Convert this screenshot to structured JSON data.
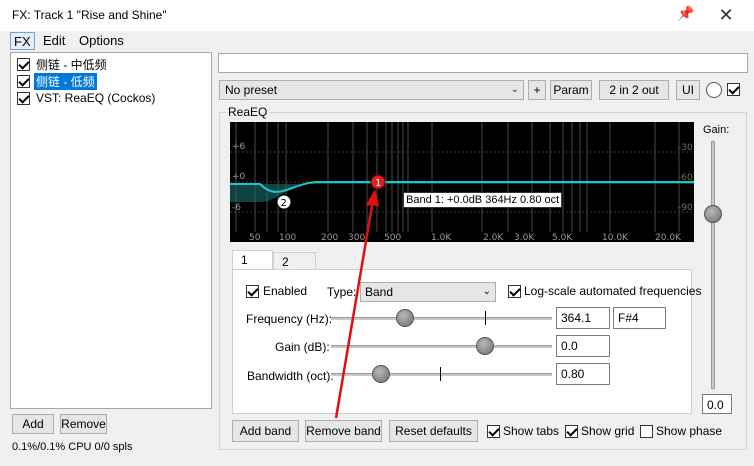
{
  "window": {
    "title": "FX: Track 1 \"Rise and Shine\""
  },
  "menu": {
    "fx": "FX",
    "edit": "Edit",
    "options": "Options"
  },
  "fx_chain": {
    "items": [
      {
        "label": "侧链 - 中低频",
        "checked": true,
        "selected": false
      },
      {
        "label": "侧链 - 低频",
        "checked": true,
        "selected": true
      },
      {
        "label": "VST: ReaEQ (Cockos)",
        "checked": true,
        "selected": false
      }
    ],
    "add_label": "Add",
    "remove_label": "Remove",
    "cpu_status": "0.1%/0.1% CPU 0/0 spls"
  },
  "plugin_header": {
    "name_field_value": "",
    "preset": "No preset",
    "plus_label": "+",
    "param_label": "Param",
    "routing_label": "2 in 2 out",
    "ui_label": "UI",
    "bypass_checked": true
  },
  "reaeq": {
    "group_label": "ReaEQ",
    "graph": {
      "db_labels_left": [
        "+6",
        "+0",
        "-6"
      ],
      "db_labels_right": [
        "-30",
        "-60",
        "-90"
      ],
      "freq_labels": [
        "50",
        "100",
        "200",
        "300",
        "500",
        "1.0K",
        "2.0K",
        "3.0K",
        "5.0K",
        "10.0K",
        "20.0K"
      ],
      "band_markers": [
        "1",
        "2"
      ],
      "tooltip": "Band 1: +0.0dB 364Hz 0.80 oct"
    },
    "gain": {
      "label": "Gain:",
      "value": "0.0"
    },
    "tabs": [
      "1",
      "2"
    ],
    "band": {
      "enabled_label": "Enabled",
      "enabled_checked": true,
      "type_label": "Type:",
      "type_value": "Band",
      "log_scale_label": "Log-scale automated frequencies",
      "log_scale_checked": true,
      "frequency_label": "Frequency (Hz):",
      "frequency_value": "364.1",
      "frequency_note": "F#4",
      "gain_label": "Gain (dB):",
      "gain_value": "0.0",
      "bandwidth_label": "Bandwidth (oct):",
      "bandwidth_value": "0.80"
    },
    "buttons": {
      "add_band": "Add band",
      "remove_band": "Remove band",
      "reset_defaults": "Reset defaults"
    },
    "checks": {
      "show_tabs": "Show tabs",
      "show_tabs_checked": true,
      "show_grid": "Show grid",
      "show_grid_checked": true,
      "show_phase": "Show phase",
      "show_phase_checked": false
    }
  },
  "colors": {
    "curve": "#19c7c7",
    "band1_marker": "#e02020",
    "annotation_arrow": "#e01010",
    "selection": "#0078d7"
  }
}
